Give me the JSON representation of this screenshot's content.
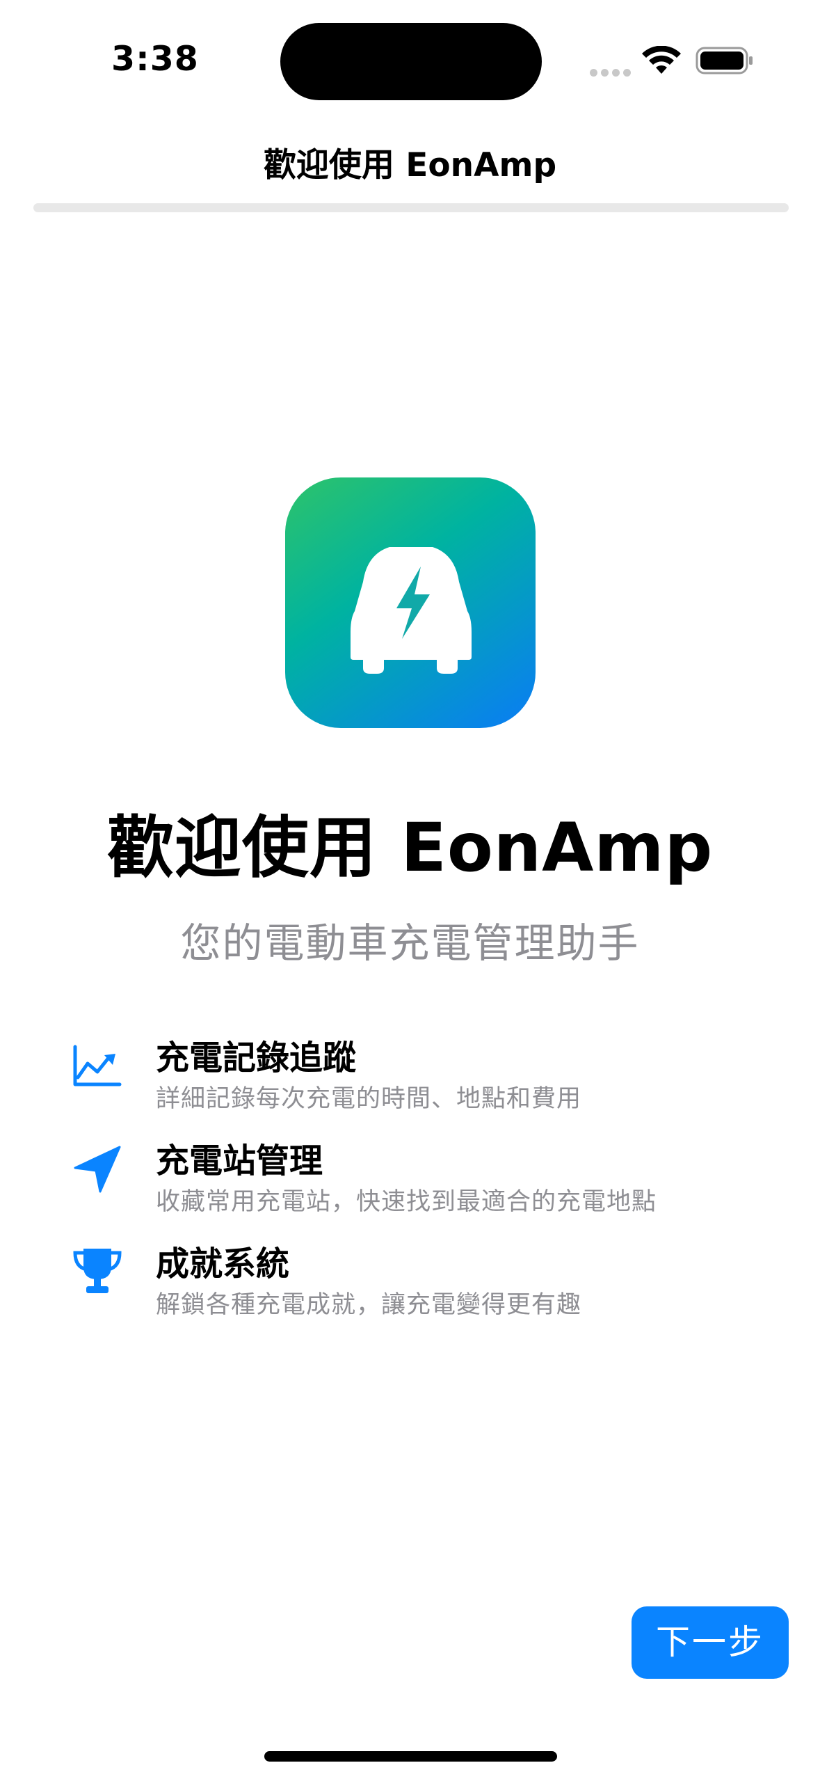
{
  "status_bar": {
    "time": "3:38"
  },
  "nav": {
    "title": "歡迎使用 EonAmp",
    "progress": 0.0
  },
  "hero": {
    "icon": "ev-car-bolt-icon",
    "title": "歡迎使用 EonAmp",
    "subtitle": "您的電動車充電管理助手"
  },
  "features": [
    {
      "icon": "chart-line-icon",
      "title": "充電記錄追蹤",
      "description": "詳細記錄每次充電的時間、地點和費用"
    },
    {
      "icon": "location-arrow-icon",
      "title": "充電站管理",
      "description": "收藏常用充電站，快速找到最適合的充電地點"
    },
    {
      "icon": "trophy-icon",
      "title": "成就系統",
      "description": "解鎖各種充電成就，讓充電變得更有趣"
    }
  ],
  "actions": {
    "next_label": "下一步"
  },
  "colors": {
    "accent": "#0a84ff",
    "secondary_text": "#8e8e93",
    "icon_gradient_start": "#2ec36a",
    "icon_gradient_end": "#0a7cf5"
  }
}
